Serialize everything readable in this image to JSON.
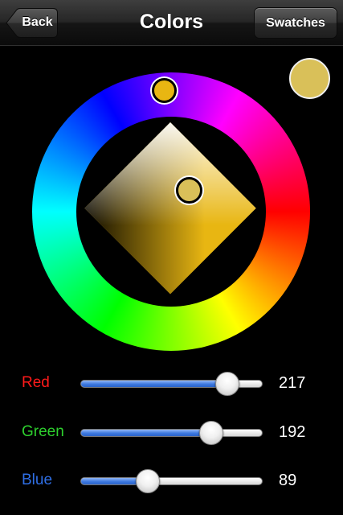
{
  "nav": {
    "title": "Colors",
    "back_label": "Back",
    "swatches_label": "Swatches"
  },
  "picker": {
    "current_color": "#d9c059",
    "hue_color": "#e8b612"
  },
  "sliders": [
    {
      "label": "Red",
      "value": "217",
      "fraction": 0.851,
      "label_color": "#ff1a1a"
    },
    {
      "label": "Green",
      "value": "192",
      "fraction": 0.753,
      "label_color": "#2ed12e"
    },
    {
      "label": "Blue",
      "value": "89",
      "fraction": 0.349,
      "label_color": "#2f6fe6"
    }
  ]
}
